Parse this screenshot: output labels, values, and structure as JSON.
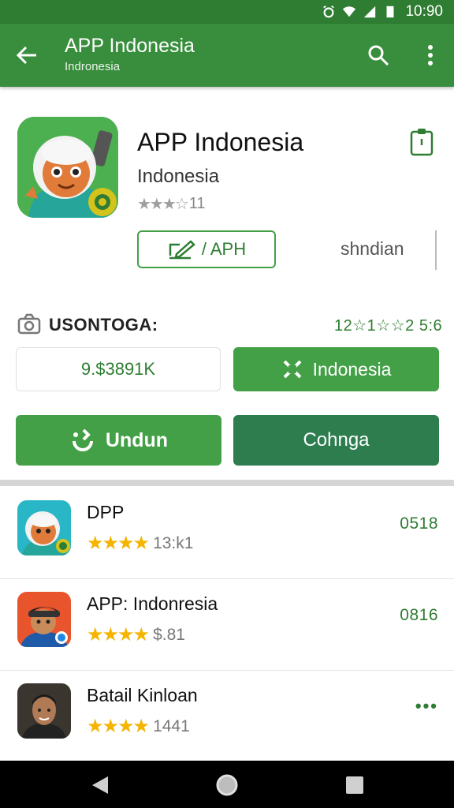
{
  "status_bar": {
    "time": "10:90"
  },
  "app_bar": {
    "title": "APP Indonesia",
    "subtitle": "Indronesia"
  },
  "app": {
    "title": "APP Indonesia",
    "developer": "Indonesia",
    "rating_count": "11",
    "apk_button_label": "/ APH",
    "side_label": "shndian"
  },
  "info_row": {
    "label": "USONTOGA:",
    "value": "12☆1☆☆2 5:6"
  },
  "actions": {
    "price": "9.$3891K",
    "indonesia_label": "Indonesia",
    "undun_label": "Undun",
    "cohnga_label": "Cohnga"
  },
  "list": [
    {
      "title": "DPP",
      "rating_text": "13:k1",
      "right": "0518"
    },
    {
      "title": "APP: Indonresia",
      "rating_text": "$.81",
      "right": "0816"
    },
    {
      "title": "Batail Kinloan",
      "rating_text": "1441",
      "right": "•••"
    }
  ],
  "colors": {
    "primary": "#388e3c",
    "primary_dark": "#2e7d32",
    "star": "#f5b400"
  }
}
